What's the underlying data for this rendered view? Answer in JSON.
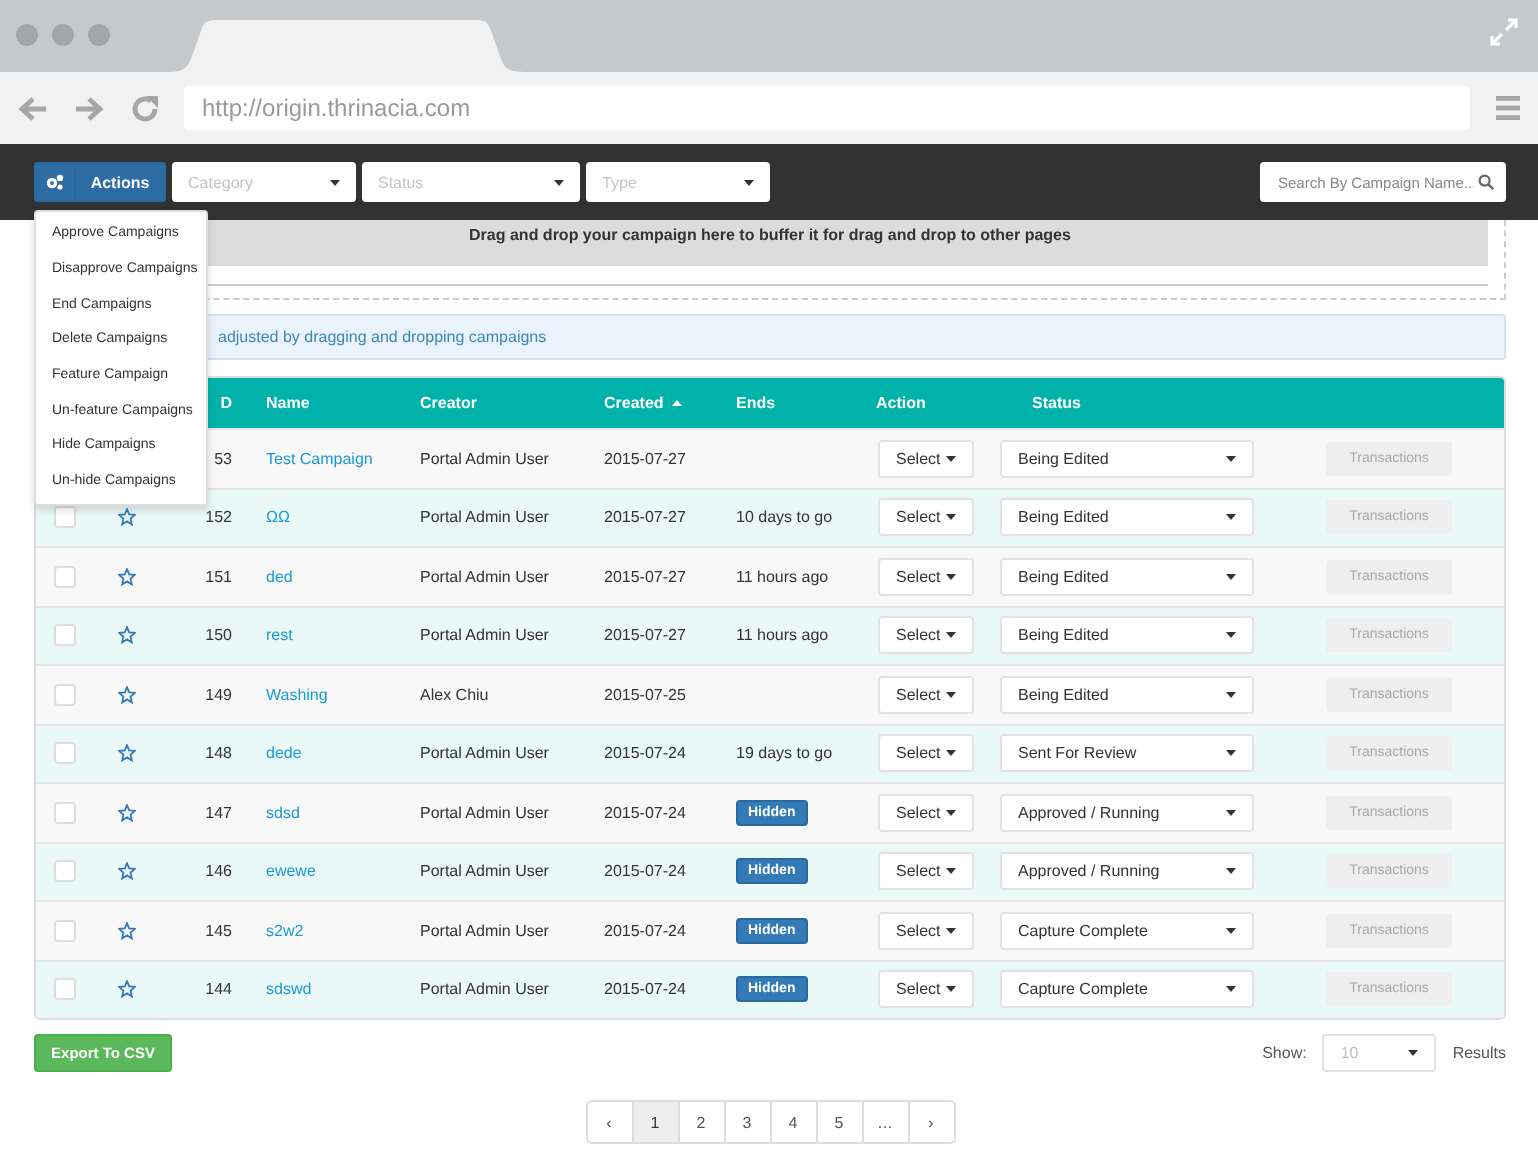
{
  "browser": {
    "url": "http://origin.thrinacia.com"
  },
  "toolbar": {
    "actions_button": {
      "label": "Actions",
      "expanded": true
    },
    "filters": [
      {
        "placeholder": "Category"
      },
      {
        "placeholder": "Status"
      },
      {
        "placeholder": "Type"
      }
    ],
    "search": {
      "placeholder": "Search By Campaign Name..."
    }
  },
  "actions_menu": [
    "Approve Campaigns",
    "Disapprove Campaigns",
    "End Campaigns",
    "Delete Campaigns",
    "Feature Campaign",
    "Un-feature Campaigns",
    "Hide Campaigns",
    "Un-hide Campaigns"
  ],
  "drop_zone": {
    "text": "Drag and drop your campaign here to buffer it for drag and drop to other pages"
  },
  "alert": {
    "text": "adjusted by dragging and dropping campaigns"
  },
  "table": {
    "columns": [
      {
        "label": "D"
      },
      {
        "label": "Name"
      },
      {
        "label": "Creator"
      },
      {
        "label": "Created",
        "sorted": true
      },
      {
        "label": "Ends"
      },
      {
        "label": "Action"
      },
      {
        "label": "Status"
      }
    ],
    "rows": [
      {
        "id": "53",
        "name": "Test Campaign",
        "creator": "Portal Admin User",
        "created": "2015-07-27",
        "action": "Select",
        "status": "Being Edited",
        "transactions": {
          "label": "Transactions",
          "disabled": true
        }
      },
      {
        "checked": false,
        "featured": false,
        "id": "152",
        "name": "ΩΩ",
        "creator": "Portal Admin User",
        "created": "2015-07-27",
        "ends": "10 days to go",
        "action": "Select",
        "status": "Being Edited",
        "transactions": {
          "label": "Transactions",
          "disabled": true
        }
      },
      {
        "checked": false,
        "featured": false,
        "id": "151",
        "name": "ded",
        "creator": "Portal Admin User",
        "created": "2015-07-27",
        "ends": "11 hours ago",
        "action": "Select",
        "status": "Being Edited",
        "transactions": {
          "label": "Transactions",
          "disabled": true
        }
      },
      {
        "checked": false,
        "featured": false,
        "id": "150",
        "name": "rest",
        "creator": "Portal Admin User",
        "created": "2015-07-27",
        "ends": "11 hours ago",
        "action": "Select",
        "status": "Being Edited",
        "transactions": {
          "label": "Transactions",
          "disabled": true
        }
      },
      {
        "checked": false,
        "featured": false,
        "id": "149",
        "name": "Washing",
        "creator": "Alex Chiu",
        "created": "2015-07-25",
        "action": "Select",
        "status": "Being Edited",
        "transactions": {
          "label": "Transactions",
          "disabled": true
        }
      },
      {
        "checked": false,
        "featured": false,
        "id": "148",
        "name": "dede",
        "creator": "Portal Admin User",
        "created": "2015-07-24",
        "ends": "19 days to go",
        "action": "Select",
        "status": "Sent For Review",
        "transactions": {
          "label": "Transactions",
          "disabled": true
        }
      },
      {
        "checked": false,
        "featured": false,
        "id": "147",
        "name": "sdsd",
        "creator": "Portal Admin User",
        "created": "2015-07-24",
        "badge": "Hidden",
        "action": "Select",
        "status": "Approved / Running",
        "transactions": {
          "label": "Transactions",
          "disabled": true
        }
      },
      {
        "checked": false,
        "featured": false,
        "id": "146",
        "name": "ewewe",
        "creator": "Portal Admin User",
        "created": "2015-07-24",
        "badge": "Hidden",
        "action": "Select",
        "status": "Approved / Running",
        "transactions": {
          "label": "Transactions",
          "disabled": true
        }
      },
      {
        "checked": false,
        "featured": false,
        "id": "145",
        "name": "s2w2",
        "creator": "Portal Admin User",
        "created": "2015-07-24",
        "badge": "Hidden",
        "action": "Select",
        "status": "Capture Complete",
        "transactions": {
          "label": "Transactions",
          "disabled": true
        }
      },
      {
        "checked": false,
        "featured": false,
        "id": "144",
        "name": "sdswd",
        "creator": "Portal Admin User",
        "created": "2015-07-24",
        "badge": "Hidden",
        "action": "Select",
        "status": "Capture Complete",
        "transactions": {
          "label": "Transactions",
          "disabled": true
        }
      }
    ]
  },
  "export_button": "Export To CSV",
  "page_size": {
    "label": "Show:",
    "value": "10",
    "suffix": "Results"
  },
  "pagination": [
    {
      "label": "‹",
      "selected": false
    },
    {
      "label": "1",
      "selected": true
    },
    {
      "label": "2",
      "selected": false
    },
    {
      "label": "3",
      "selected": false
    },
    {
      "label": "4",
      "selected": false
    },
    {
      "label": "5",
      "selected": false
    },
    {
      "label": "…",
      "selected": false
    },
    {
      "label": "›",
      "selected": false
    }
  ]
}
